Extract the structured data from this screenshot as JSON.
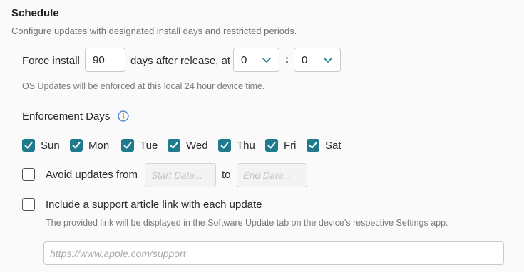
{
  "section": {
    "title": "Schedule",
    "subtitle": "Configure updates with designated install days and restricted periods."
  },
  "force_install": {
    "label_before": "Force install",
    "days_value": "90",
    "label_after": "days after release, at",
    "hour_value": "0",
    "separator": ":",
    "minute_value": "0",
    "note": "OS Updates will be enforced at this local 24 hour device time."
  },
  "enforcement": {
    "label": "Enforcement Days",
    "days": [
      {
        "label": "Sun",
        "checked": true
      },
      {
        "label": "Mon",
        "checked": true
      },
      {
        "label": "Tue",
        "checked": true
      },
      {
        "label": "Wed",
        "checked": true
      },
      {
        "label": "Thu",
        "checked": true
      },
      {
        "label": "Fri",
        "checked": true
      },
      {
        "label": "Sat",
        "checked": true
      }
    ]
  },
  "avoid_updates": {
    "checked": false,
    "label": "Avoid updates from",
    "start_placeholder": "Start Date...",
    "to_label": "to",
    "end_placeholder": "End Date..."
  },
  "support_link": {
    "checked": false,
    "label": "Include a support article link with each update",
    "note": "The provided link will be displayed in the Software Update tab on the device's respective Settings app.",
    "url_placeholder": "https://www.apple.com/support"
  },
  "colors": {
    "accent": "#1f7b8c",
    "info_icon": "#3d7fd9"
  },
  "icons": {
    "select": "chevron-down-icon",
    "info": "info-circle-icon",
    "check": "checkmark-icon"
  }
}
